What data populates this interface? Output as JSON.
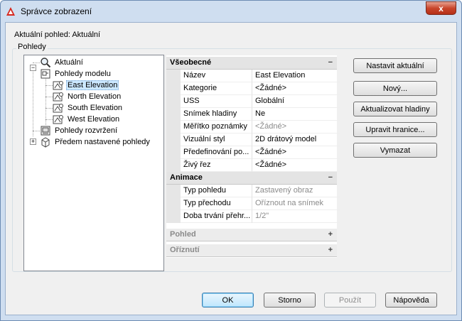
{
  "window": {
    "title": "Správce zobrazení",
    "close_glyph": "x"
  },
  "current_view_label": "Aktuální pohled: Aktuální",
  "group_title": "Pohledy",
  "tree": {
    "current": "Aktuální",
    "model_views": "Pohledy modelu",
    "east": "East Elevation",
    "north": "North Elevation",
    "south": "South Elevation",
    "west": "West Elevation",
    "layout_views": "Pohledy rozvržení",
    "preset_views": "Předem nastavené pohledy",
    "collapse_glyph": "−",
    "expand_glyph": "+"
  },
  "props": {
    "general": {
      "title": "Všeobecné",
      "toggle": "−",
      "rows": [
        {
          "name": "Název",
          "value": "East Elevation"
        },
        {
          "name": "Kategorie",
          "value": "<Žádné>"
        },
        {
          "name": "USS",
          "value": "Globální"
        },
        {
          "name": "Snímek hladiny",
          "value": "Ne"
        },
        {
          "name": "Měřítko poznámky",
          "value": "<Žádné>"
        },
        {
          "name": "Vizuální styl",
          "value": "2D drátový model"
        },
        {
          "name": "Předefinování po...",
          "value": "<Žádné>"
        },
        {
          "name": "Živý řez",
          "value": "<Žádné>"
        }
      ]
    },
    "animation": {
      "title": "Animace",
      "toggle": "−",
      "rows": [
        {
          "name": "Typ pohledu",
          "value": "Zastavený obraz"
        },
        {
          "name": "Typ přechodu",
          "value": "Oříznout na snímek"
        },
        {
          "name": "Doba trvání přehr...",
          "value": "1/2\""
        }
      ]
    },
    "view": {
      "title": "Pohled",
      "toggle": "+"
    },
    "clip": {
      "title": "Oříznutí",
      "toggle": "+"
    }
  },
  "side_buttons": {
    "set_current": "Nastavit aktuální",
    "new": "Nový...",
    "update_layers": "Aktualizovat hladiny",
    "edit_boundaries": "Upravit hranice...",
    "delete": "Vymazat"
  },
  "bottom_buttons": {
    "ok": "OK",
    "cancel": "Storno",
    "apply": "Použít",
    "help": "Nápověda"
  },
  "colors": {
    "accent": "#3c7fb1",
    "selection": "#cce8ff",
    "close": "#c9462c"
  }
}
